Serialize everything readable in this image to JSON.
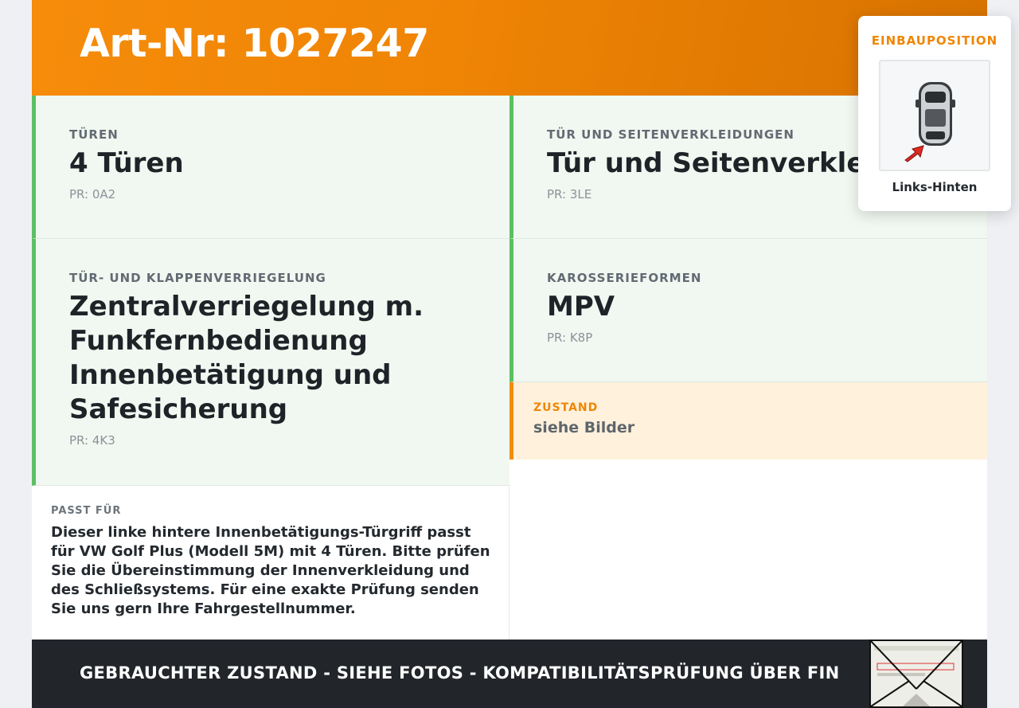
{
  "header": {
    "title": "Art-Nr: 1027247"
  },
  "cells": {
    "tueren": {
      "label": "TÜREN",
      "value": "4 Türen",
      "pr": "PR: 0A2"
    },
    "verkleidung": {
      "label": "TÜR UND SEITENVERKLEIDUNGEN",
      "value": "Tür und Seitenverkleidungen",
      "pr": "PR: 3LE"
    },
    "verriegelung": {
      "label": "TÜR- UND KLAPPENVERRIEGELUNG",
      "value": "Zentralverriegelung m. Funkfernbedienung Innenbetätigung und Safesicherung",
      "pr": "PR: 4K3"
    },
    "karosserie": {
      "label": "KAROSSERIEFORMEN",
      "value": "MPV",
      "pr": "PR: K8P"
    }
  },
  "zustand": {
    "label": "ZUSTAND",
    "value": "siehe Bilder"
  },
  "passt": {
    "label": "PASST FÜR",
    "text": "Dieser linke hintere Innenbetätigungs-Türgriff passt für VW Golf Plus (Modell 5M) mit 4 Türen. Bitte prüfen Sie die Übereinstimmung der Innenverkleidung und des Schließsystems. Für eine exakte Prüfung senden Sie uns gern Ihre Fahrgestellnummer."
  },
  "footer": {
    "text": "GEBRAUCHTER ZUSTAND - SIEHE FOTOS - KOMPATIBILITÄTSPRÜFUNG ÜBER FIN"
  },
  "popup": {
    "title": "EINBAUPOSITION",
    "position_label": "Links-Hinten"
  },
  "colors": {
    "accent": "#f28c0f",
    "green": "#5cbf62",
    "footer": "#22252a",
    "arrow": "#e02b20"
  },
  "icons": {
    "car": "car-top-view-icon",
    "arrow": "red-arrow-icon",
    "document": "vehicle-registration-document-icon"
  }
}
